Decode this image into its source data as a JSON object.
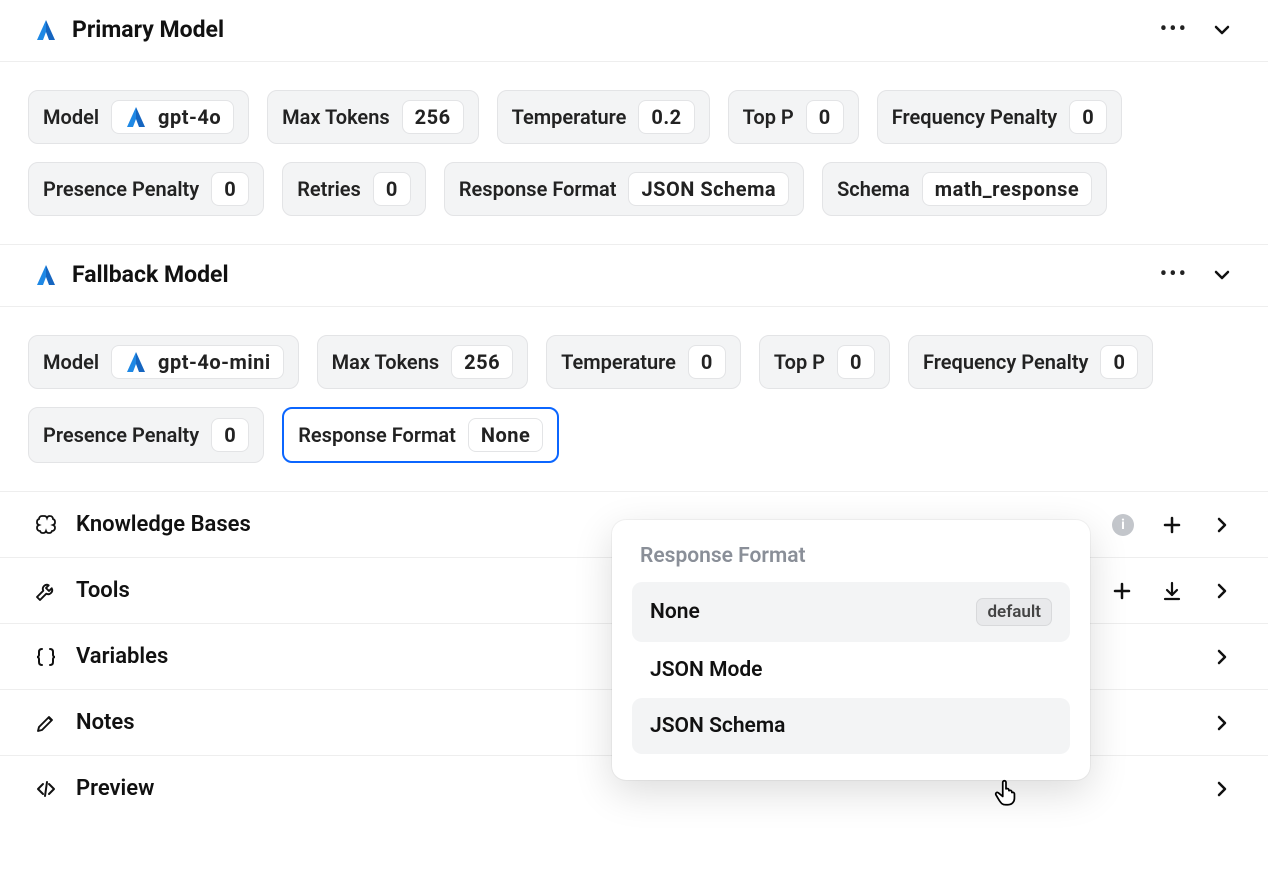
{
  "primary": {
    "title": "Primary Model",
    "params": {
      "model_label": "Model",
      "model_value": "gpt-4o",
      "max_tokens_label": "Max Tokens",
      "max_tokens_value": "256",
      "temperature_label": "Temperature",
      "temperature_value": "0.2",
      "top_p_label": "Top P",
      "top_p_value": "0",
      "frequency_penalty_label": "Frequency Penalty",
      "frequency_penalty_value": "0",
      "presence_penalty_label": "Presence Penalty",
      "presence_penalty_value": "0",
      "retries_label": "Retries",
      "retries_value": "0",
      "response_format_label": "Response Format",
      "response_format_value": "JSON Schema",
      "schema_label": "Schema",
      "schema_value": "math_response"
    }
  },
  "fallback": {
    "title": "Fallback Model",
    "params": {
      "model_label": "Model",
      "model_value": "gpt-4o-mini",
      "max_tokens_label": "Max Tokens",
      "max_tokens_value": "256",
      "temperature_label": "Temperature",
      "temperature_value": "0",
      "top_p_label": "Top P",
      "top_p_value": "0",
      "frequency_penalty_label": "Frequency Penalty",
      "frequency_penalty_value": "0",
      "presence_penalty_label": "Presence Penalty",
      "presence_penalty_value": "0",
      "response_format_label": "Response Format",
      "response_format_value": "None"
    }
  },
  "rows": {
    "knowledge_bases": "Knowledge Bases",
    "tools": "Tools",
    "variables": "Variables",
    "notes": "Notes",
    "preview": "Preview"
  },
  "dropdown": {
    "title": "Response Format",
    "options": [
      {
        "label": "None",
        "badge": "default"
      },
      {
        "label": "JSON Mode"
      },
      {
        "label": "JSON Schema"
      }
    ]
  }
}
